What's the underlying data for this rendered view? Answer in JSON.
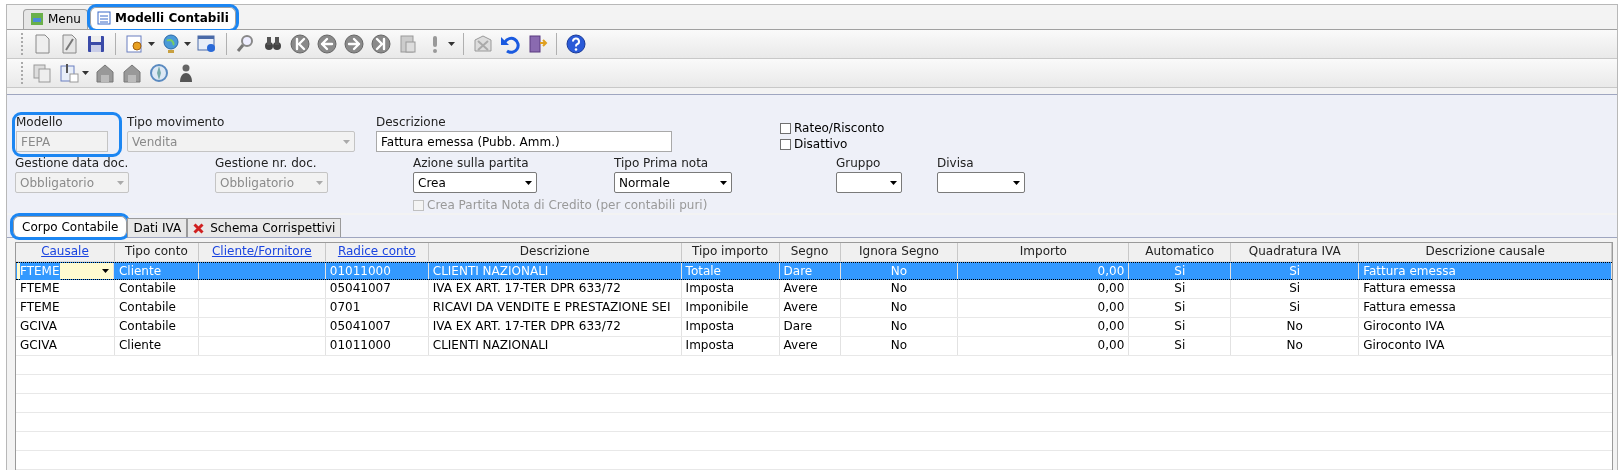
{
  "doc_tabs": [
    {
      "label": "Menu",
      "selected": false,
      "highlighted": false
    },
    {
      "label": "Modelli Contabili",
      "selected": true,
      "highlighted": true
    }
  ],
  "form": {
    "modello": {
      "label": "Modello",
      "value": "FEPA",
      "disabled": true,
      "highlighted": true
    },
    "tipo_movimento": {
      "label": "Tipo movimento",
      "value": "Vendita",
      "disabled": true
    },
    "descrizione": {
      "label": "Descrizione",
      "value": "Fattura emessa (Pubb. Amm.)"
    },
    "checkboxes": [
      {
        "label": "Rateo/Risconto",
        "checked": false
      },
      {
        "label": "Disattivo",
        "checked": false
      }
    ],
    "row2": [
      {
        "label": "Gestione data doc.",
        "value": "Obbligatorio",
        "disabled": true
      },
      {
        "label": "Gestione nr. doc.",
        "value": "Obbligatorio",
        "disabled": true
      },
      {
        "label": "Azione sulla partita",
        "value": "Crea",
        "disabled": false
      },
      {
        "label": "Tipo Prima nota",
        "value": "Normale",
        "disabled": false
      },
      {
        "label": "Gruppo",
        "disabled": false
      },
      {
        "label": "Divisa",
        "disabled": false
      }
    ],
    "nota_credito": {
      "label": "Crea Partita Nota di Credito (per contabili puri)",
      "checked": false,
      "disabled": true
    }
  },
  "section_tabs": [
    {
      "label": "Corpo Contabile",
      "selected": true,
      "highlighted": true,
      "error": false
    },
    {
      "label": "Dati IVA",
      "selected": false,
      "highlighted": false,
      "error": false
    },
    {
      "label": "Schema Corrispettivi",
      "selected": false,
      "highlighted": false,
      "error": true
    }
  ],
  "table": {
    "columns": [
      {
        "label": "Causale",
        "link": true
      },
      {
        "label": "Tipo conto",
        "link": false
      },
      {
        "label": "Cliente/Fornitore",
        "link": true
      },
      {
        "label": "Radice conto",
        "link": true
      },
      {
        "label": "Descrizione",
        "link": false
      },
      {
        "label": "Tipo importo",
        "link": false
      },
      {
        "label": "Segno",
        "link": false
      },
      {
        "label": "Ignora Segno",
        "link": false
      },
      {
        "label": "Importo",
        "link": false
      },
      {
        "label": "Automatico",
        "link": false
      },
      {
        "label": "Quadratura IVA",
        "link": false
      },
      {
        "label": "Descrizione causale",
        "link": false
      }
    ],
    "rows": [
      {
        "selected": true,
        "cells": [
          "FTEME",
          "Cliente",
          "",
          "01011000",
          "CLIENTI NAZIONALI",
          "Totale",
          "Dare",
          "No",
          "0,00",
          "Si",
          "Si",
          "Fattura emessa"
        ]
      },
      {
        "selected": false,
        "cells": [
          "FTEME",
          "Contabile",
          "",
          "05041007",
          "IVA EX ART. 17-TER DPR 633/72",
          "Imposta",
          "Avere",
          "No",
          "0,00",
          "Si",
          "Si",
          "Fattura emessa"
        ]
      },
      {
        "selected": false,
        "cells": [
          "FTEME",
          "Contabile",
          "",
          "0701",
          "RICAVI DA VENDITE E PRESTAZIONE SEI",
          "Imponibile",
          "Avere",
          "No",
          "0,00",
          "Si",
          "Si",
          "Fattura emessa"
        ]
      },
      {
        "selected": false,
        "cells": [
          "GCIVA",
          "Contabile",
          "",
          "05041007",
          "IVA EX ART. 17-TER DPR 633/72",
          "Imposta",
          "Dare",
          "No",
          "0,00",
          "Si",
          "No",
          "Giroconto IVA"
        ]
      },
      {
        "selected": false,
        "cells": [
          "GCIVA",
          "Cliente",
          "",
          "01011000",
          "CLIENTI NAZIONALI",
          "Imposta",
          "Avere",
          "No",
          "0,00",
          "Si",
          "No",
          "Giroconto IVA"
        ]
      }
    ]
  }
}
